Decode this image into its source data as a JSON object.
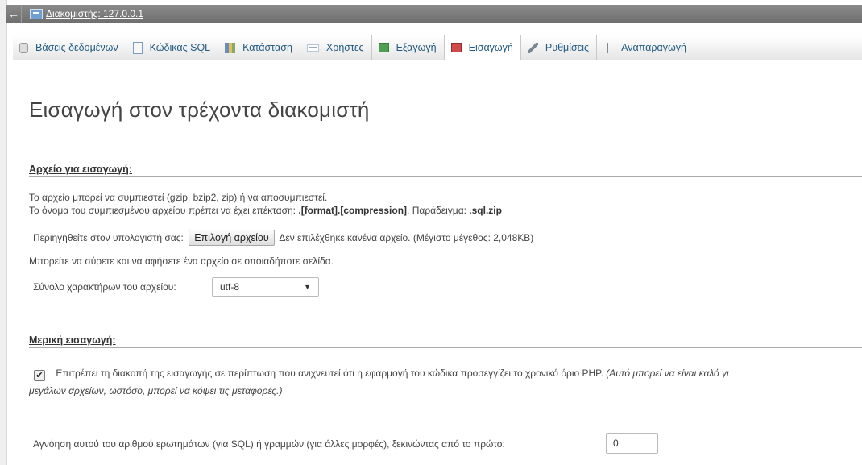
{
  "server_bar": {
    "back_glyph": "←",
    "title": "Διακομιστής: 127.0.0.1"
  },
  "tabs": [
    {
      "label": "Βάσεις δεδομένων",
      "icon": "database-icon"
    },
    {
      "label": "Κώδικας SQL",
      "icon": "sql-icon"
    },
    {
      "label": "Κατάσταση",
      "icon": "status-icon"
    },
    {
      "label": "Χρήστες",
      "icon": "users-icon"
    },
    {
      "label": "Εξαγωγή",
      "icon": "export-icon"
    },
    {
      "label": "Εισαγωγή",
      "icon": "import-icon",
      "active": true
    },
    {
      "label": "Ρυθμίσεις",
      "icon": "settings-icon"
    },
    {
      "label": "Αναπαραγωγή",
      "icon": "replication-icon"
    }
  ],
  "page_title": "Εισαγωγή στον τρέχοντα διακομιστή",
  "file_section": {
    "title": "Αρχείο για εισαγωγή:",
    "compress_note": "Το αρχείο μπορεί να συμπιεστεί (gzip, bzip2, zip) ή να αποσυμπιεστεί.",
    "ext_note_prefix": "Το όνομα του συμπιεσμένου αρχείου πρέπει να έχει επέκταση: ",
    "ext_format": ".[format].[compression]",
    "ext_example_prefix": ". Παράδειγμα: ",
    "ext_example": ".sql.zip",
    "browse_label": "Περιηγηθείτε στον υπολογιστή σας:",
    "choose_button": "Επιλογή αρχείου",
    "no_file_text": "Δεν επιλέχθηκε κανένα αρχείο. (Μέγιστο μέγεθος: 2,048KB)",
    "drag_note": "Μπορείτε να σύρετε και να αφήσετε ένα αρχείο σε οποιαδήποτε σελίδα.",
    "charset_label": "Σύνολο χαρακτήρων του αρχείου:",
    "charset_value": "utf-8"
  },
  "partial_section": {
    "title": "Μερική εισαγωγή:",
    "allow_interrupt_checked": true,
    "allow_interrupt_text": "Επιτρέπει τη διακοπή της εισαγωγής σε περίπτωση που ανιχνευτεί ότι η εφαρμογή του κώδικα προσεγγίζει το χρονικό όριο PHP.",
    "allow_interrupt_hint_1": "(Αυτό μπορεί να είναι καλό γι",
    "allow_interrupt_hint_2": "μεγάλων αρχείων, ωστόσο, μπορεί να κόψει τις μεταφορές.)",
    "skip_label": "Αγνόηση αυτού του αριθμού ερωτημάτων (για SQL) ή γραμμών (για άλλες μορφές), ξεκινώντας από το πρώτο:",
    "skip_value": "0"
  }
}
